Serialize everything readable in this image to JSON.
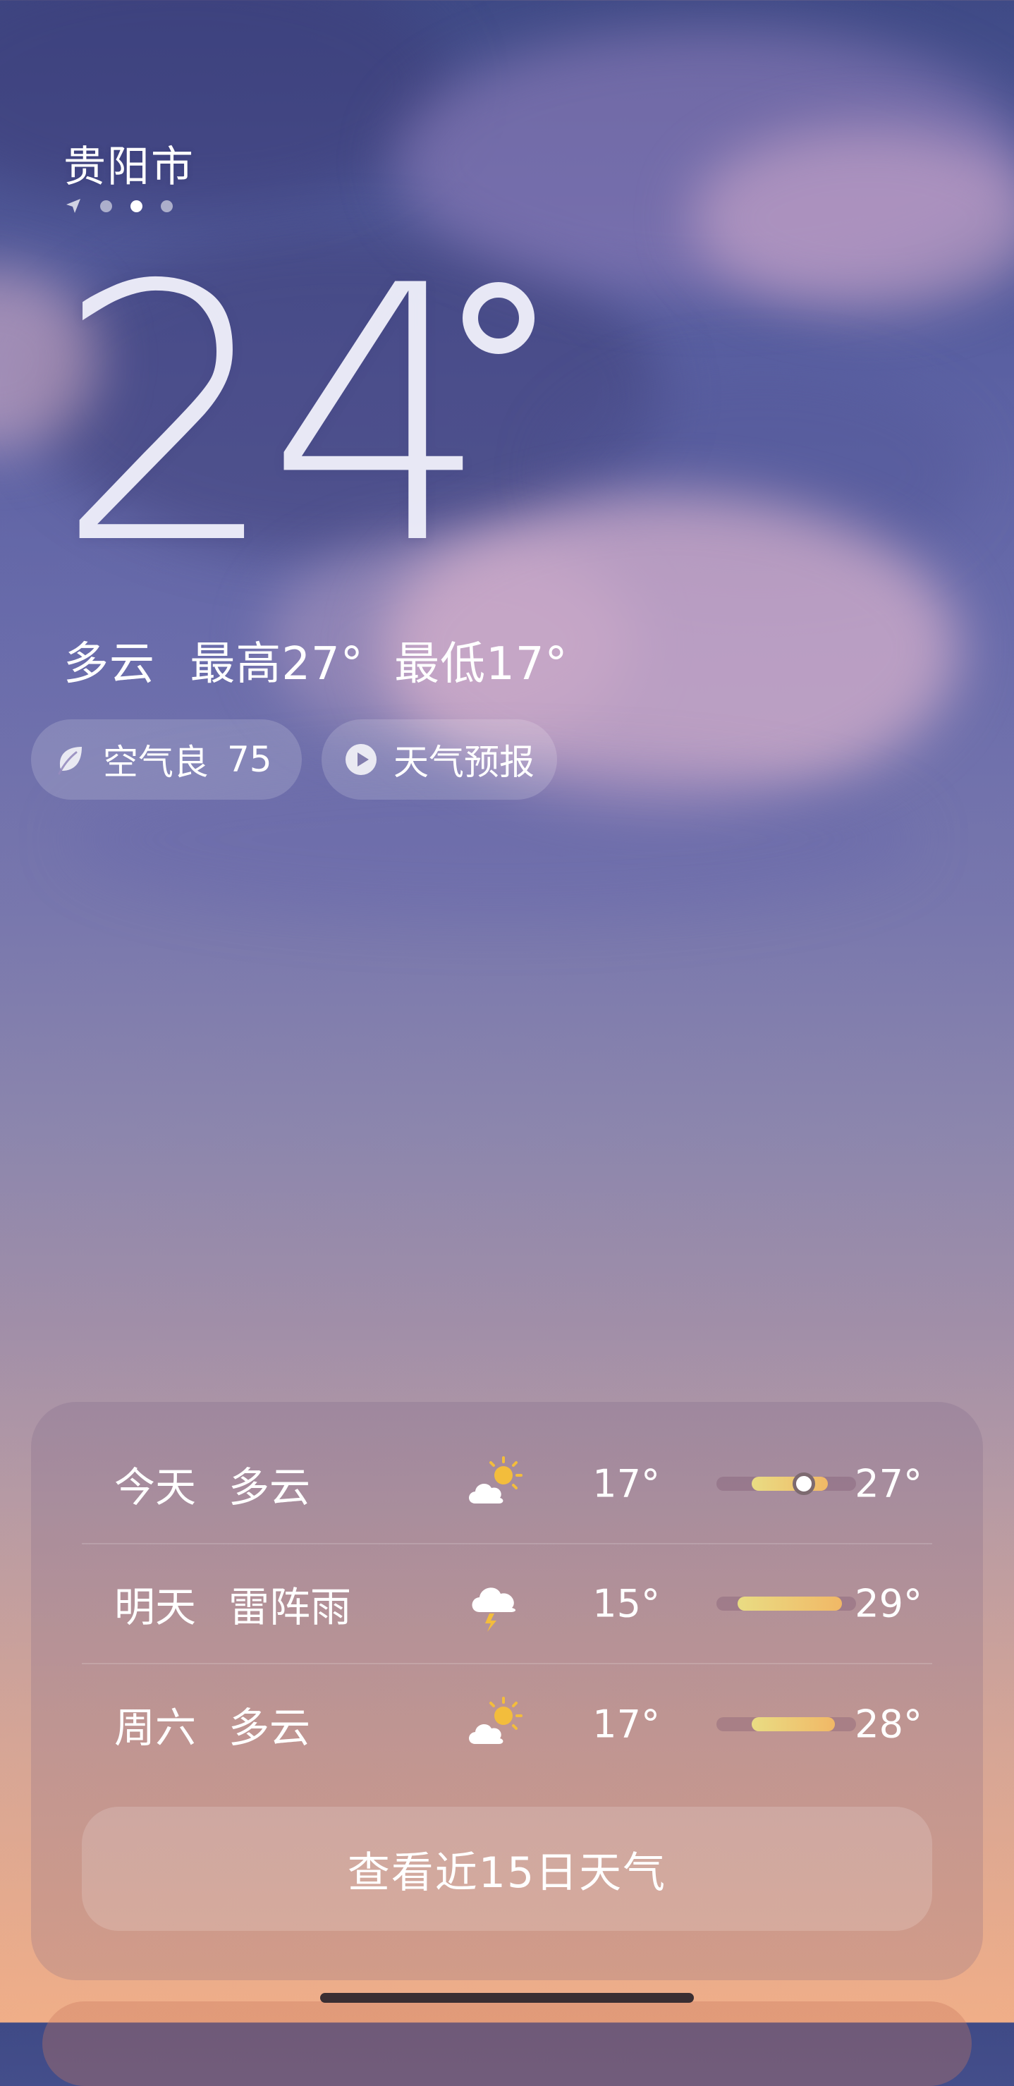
{
  "location": {
    "city": "贵阳市",
    "page_indicator": {
      "icons": [
        "location-arrow-icon"
      ],
      "dots": 3,
      "active_dot": 1
    }
  },
  "current": {
    "temperature": "24",
    "condition": "多云",
    "high": "最高27°",
    "low": "最低17°"
  },
  "pills": {
    "air_quality": {
      "icon": "leaf-icon",
      "label": "空气良",
      "value": "75"
    },
    "forecast_video": {
      "icon": "play-circle-icon",
      "label": "天气预报"
    }
  },
  "forecast": {
    "days": [
      {
        "day": "今天",
        "condition": "多云",
        "icon": "partly-cloudy-sun-icon",
        "low": "17°",
        "high": "27°",
        "range_start": 0.25,
        "range_end": 0.8,
        "current_marker": 0.6
      },
      {
        "day": "明天",
        "condition": "雷阵雨",
        "icon": "thunderstorm-icon",
        "low": "15°",
        "high": "29°",
        "range_start": 0.15,
        "range_end": 0.9
      },
      {
        "day": "周六",
        "condition": "多云",
        "icon": "partly-cloudy-sun-icon",
        "low": "17°",
        "high": "28°",
        "range_start": 0.25,
        "range_end": 0.85
      }
    ],
    "more_button_label": "查看近15日天气"
  },
  "colors": {
    "range_bar_start": "#e9dc83",
    "range_bar_end": "#f1b866",
    "sun": "#f3bd3c"
  }
}
